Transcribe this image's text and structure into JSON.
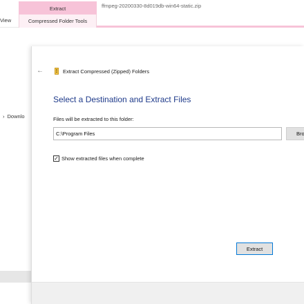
{
  "explorer": {
    "ribbon_tab_extract": "Extract",
    "ribbon_tab_view": "View",
    "ribbon_tab_compressed": "Compressed Folder Tools",
    "window_title": "ffmpeg-20200330-8d019db-win64-static.zip",
    "nav_item_downloads": "Downlo",
    "nav_item_chevron": "›",
    "accent_color": "#f7c3d8"
  },
  "dialog": {
    "back_icon": "←",
    "title": "Extract Compressed (Zipped) Folders",
    "heading": "Select a Destination and Extract Files",
    "path_label": "Files will be extracted to this folder:",
    "path_value": "C:\\Program Files",
    "browse_label": "Bro",
    "checkbox_checked": true,
    "checkbox_mark": "✓",
    "checkbox_label": "Show extracted files when complete",
    "extract_label": "Extract",
    "heading_color": "#1e3a8a"
  }
}
